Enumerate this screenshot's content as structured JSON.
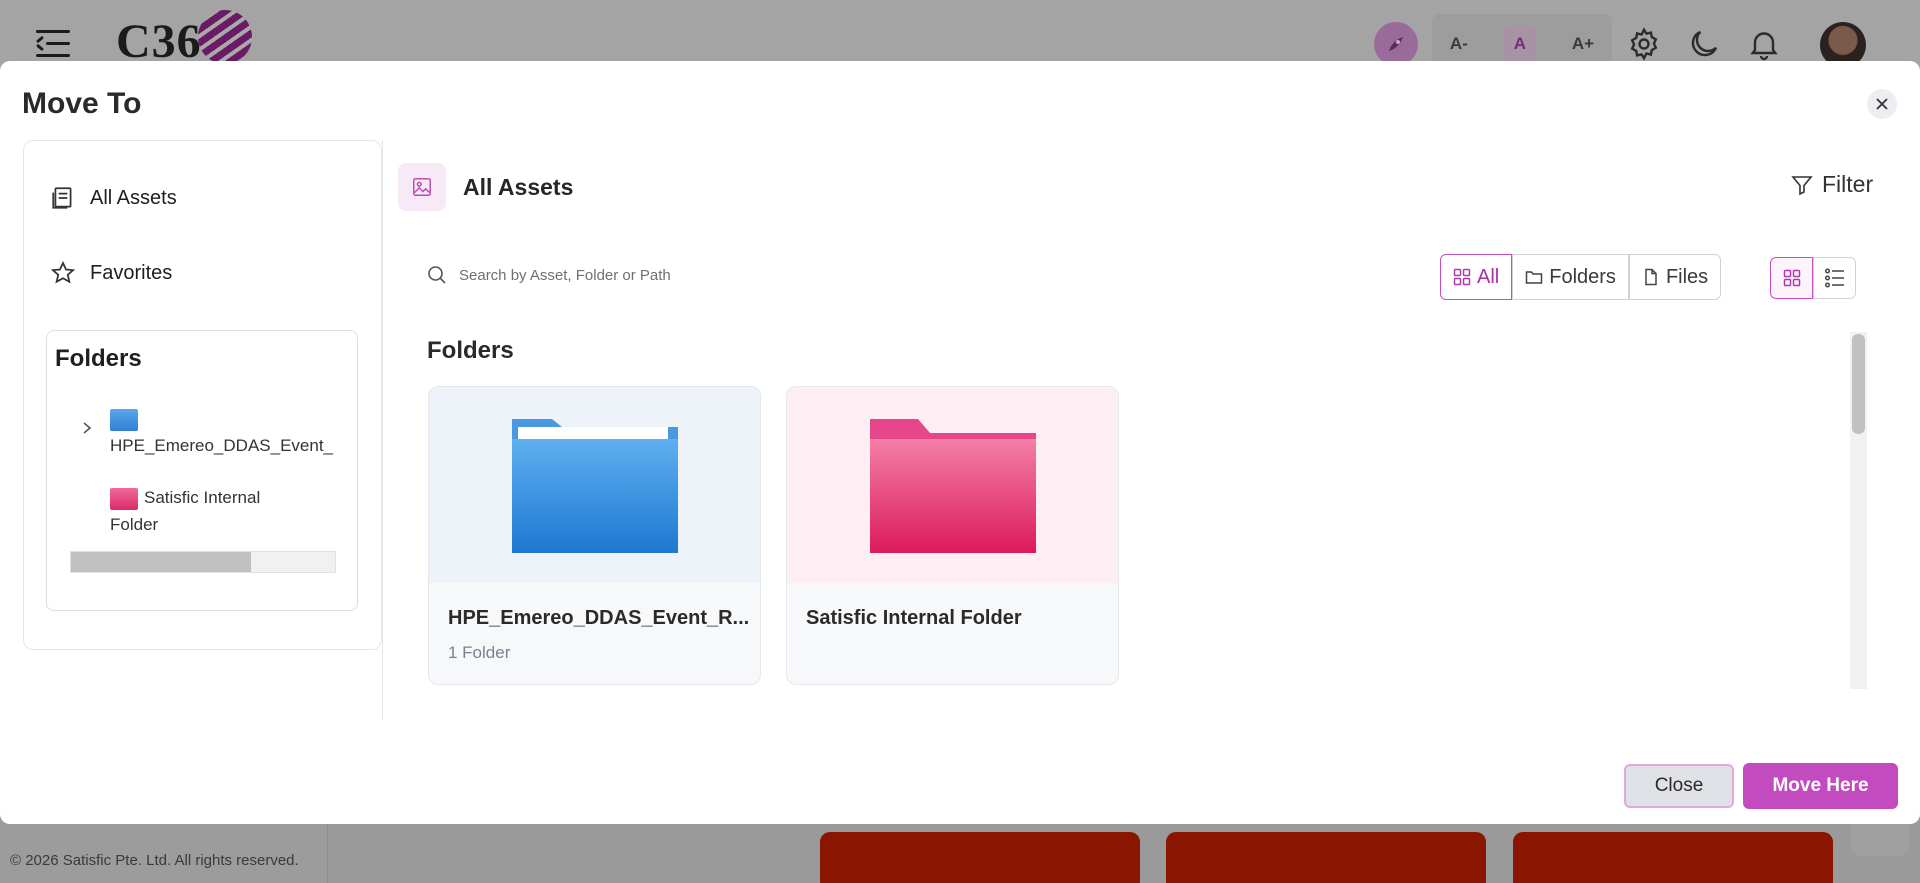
{
  "app": {
    "logo_text": "C36",
    "font_size_controls": [
      "A-",
      "A",
      "A+"
    ],
    "footer": "© 2026 Satisfic Pte. Ltd. All rights reserved."
  },
  "modal": {
    "title": "Move To",
    "sidebar": {
      "items": [
        {
          "label": "All Assets",
          "icon": "assets-icon"
        },
        {
          "label": "Favorites",
          "icon": "star-icon"
        }
      ],
      "folders_heading": "Folders",
      "tree": [
        {
          "label": "HPE_Emereo_DDAS_Event_",
          "color": "#3f8fe0",
          "expandable": true
        },
        {
          "label": "Satisfic Internal Folder",
          "color": "#e0407f",
          "expandable": false
        }
      ]
    },
    "header": {
      "title": "All Assets",
      "filter_label": "Filter"
    },
    "search": {
      "placeholder": "Search by Asset, Folder or Path"
    },
    "type_filter": {
      "options": [
        "All",
        "Folders",
        "Files"
      ],
      "selected": "All"
    },
    "view_mode": "grid",
    "section_title": "Folders",
    "cards": [
      {
        "name": "HPE_Emereo_DDAS_Event_R...",
        "meta": "1 Folder",
        "color": "#2f86dd"
      },
      {
        "name": "Satisfic Internal Folder",
        "meta": "",
        "color": "#e2336f"
      }
    ],
    "footer": {
      "close_label": "Close",
      "confirm_label": "Move Here"
    },
    "accent_color": "#c24cbf"
  }
}
